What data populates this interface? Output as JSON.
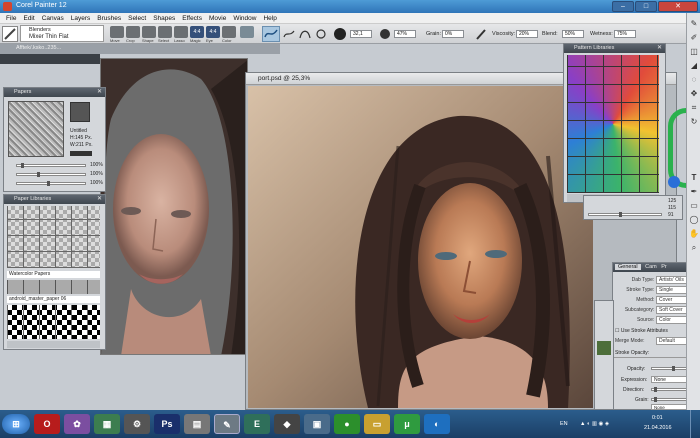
{
  "window": {
    "title": "Corel Painter 12"
  },
  "menu": [
    "File",
    "Edit",
    "Canvas",
    "Layers",
    "Brushes",
    "Select",
    "Shapes",
    "Effects",
    "Movie",
    "Window",
    "Help"
  ],
  "property_bar": {
    "brush_category": "Blenders",
    "brush_variant": "Mixer Thin Flat",
    "tool_icons": [
      "Move",
      "Crop",
      "Shape",
      "Select",
      "Lasso",
      "Magic",
      "Eye",
      "Color"
    ],
    "size_value": "32,1",
    "opacity_value": "47%",
    "grain_label": "Grain:",
    "grain_value": "0%",
    "viscosity_label": "Viscosity:",
    "viscosity_value": "20%",
    "blend_label": "Blend:",
    "blend_value": "50%",
    "wetness_label": "Wetness:",
    "wetness_value": "75%"
  },
  "tabstrip": {
    "label": "Afftek/.ksko..235..."
  },
  "papers_panel": {
    "title": "Papers",
    "paper_name": "Untitled",
    "h_value": "H:145 Px.",
    "w_value": "W:211 Px.",
    "slider1": "100%",
    "slider2": "100%",
    "slider3": "100%"
  },
  "paper_libraries_panel": {
    "title": "Paper Libraries",
    "lib1": "Watercolor Papers",
    "lib2": "android_master_paper 06"
  },
  "main_document": {
    "title": "port.psd @ 25,3%"
  },
  "pattern_libraries_panel": {
    "title": "Pattern Libraries",
    "values": [
      "125",
      "115",
      "91"
    ]
  },
  "general_panel": {
    "tabs": [
      "General",
      "Cam",
      "Pr"
    ],
    "rows": [
      {
        "label": "Dab Type:",
        "value": "Artists' Oils"
      },
      {
        "label": "Stroke Type:",
        "value": "Single"
      },
      {
        "label": "Method:",
        "value": "Cover"
      },
      {
        "label": "Subcategory:",
        "value": "Soft Cover"
      },
      {
        "label": "Source:",
        "value": "Color"
      }
    ],
    "stroke_attr": "Use Stroke Attributes",
    "merge_label": "Merge Mode:",
    "merge_value": "Default",
    "stroke_opacity": "Stroke Opacity:",
    "opacity_label": "Opacity:",
    "expression_label": "Expression:",
    "expression_value": "None",
    "direction_label": "Direction:",
    "grain_label": "Grain:",
    "expression2_value": "None"
  },
  "taskbar": {
    "language": "EN",
    "time": "0:01",
    "date": "21.04.2016"
  },
  "colors": {
    "title_bar": "#2f74b8",
    "panel_header": "#3f464e",
    "taskbar": "#1b3f66",
    "accent_green": "#2ab14d"
  }
}
